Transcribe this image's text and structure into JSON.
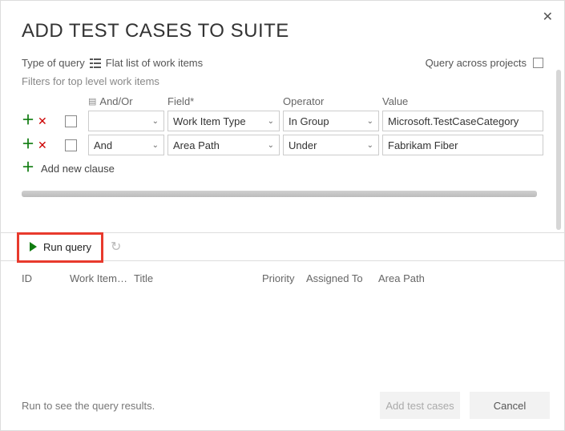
{
  "title": "ADD TEST CASES TO SUITE",
  "queryType": {
    "label": "Type of query",
    "value": "Flat list of work items"
  },
  "queryAcross": {
    "label": "Query across projects"
  },
  "filtersLabel": "Filters for top level work items",
  "headers": {
    "andor": "And/Or",
    "field": "Field*",
    "operator": "Operator",
    "value": "Value"
  },
  "rows": [
    {
      "andor": "",
      "field": "Work Item Type",
      "operator": "In Group",
      "value": "Microsoft.TestCaseCategory"
    },
    {
      "andor": "And",
      "field": "Area Path",
      "operator": "Under",
      "value": "Fabrikam Fiber"
    }
  ],
  "addClause": "Add new clause",
  "runQuery": "Run query",
  "resultCols": {
    "id": "ID",
    "workItem": "Work Item…",
    "title": "Title",
    "priority": "Priority",
    "assigned": "Assigned To",
    "area": "Area Path"
  },
  "footerMsg": "Run to see the query results.",
  "buttons": {
    "add": "Add test cases",
    "cancel": "Cancel"
  }
}
